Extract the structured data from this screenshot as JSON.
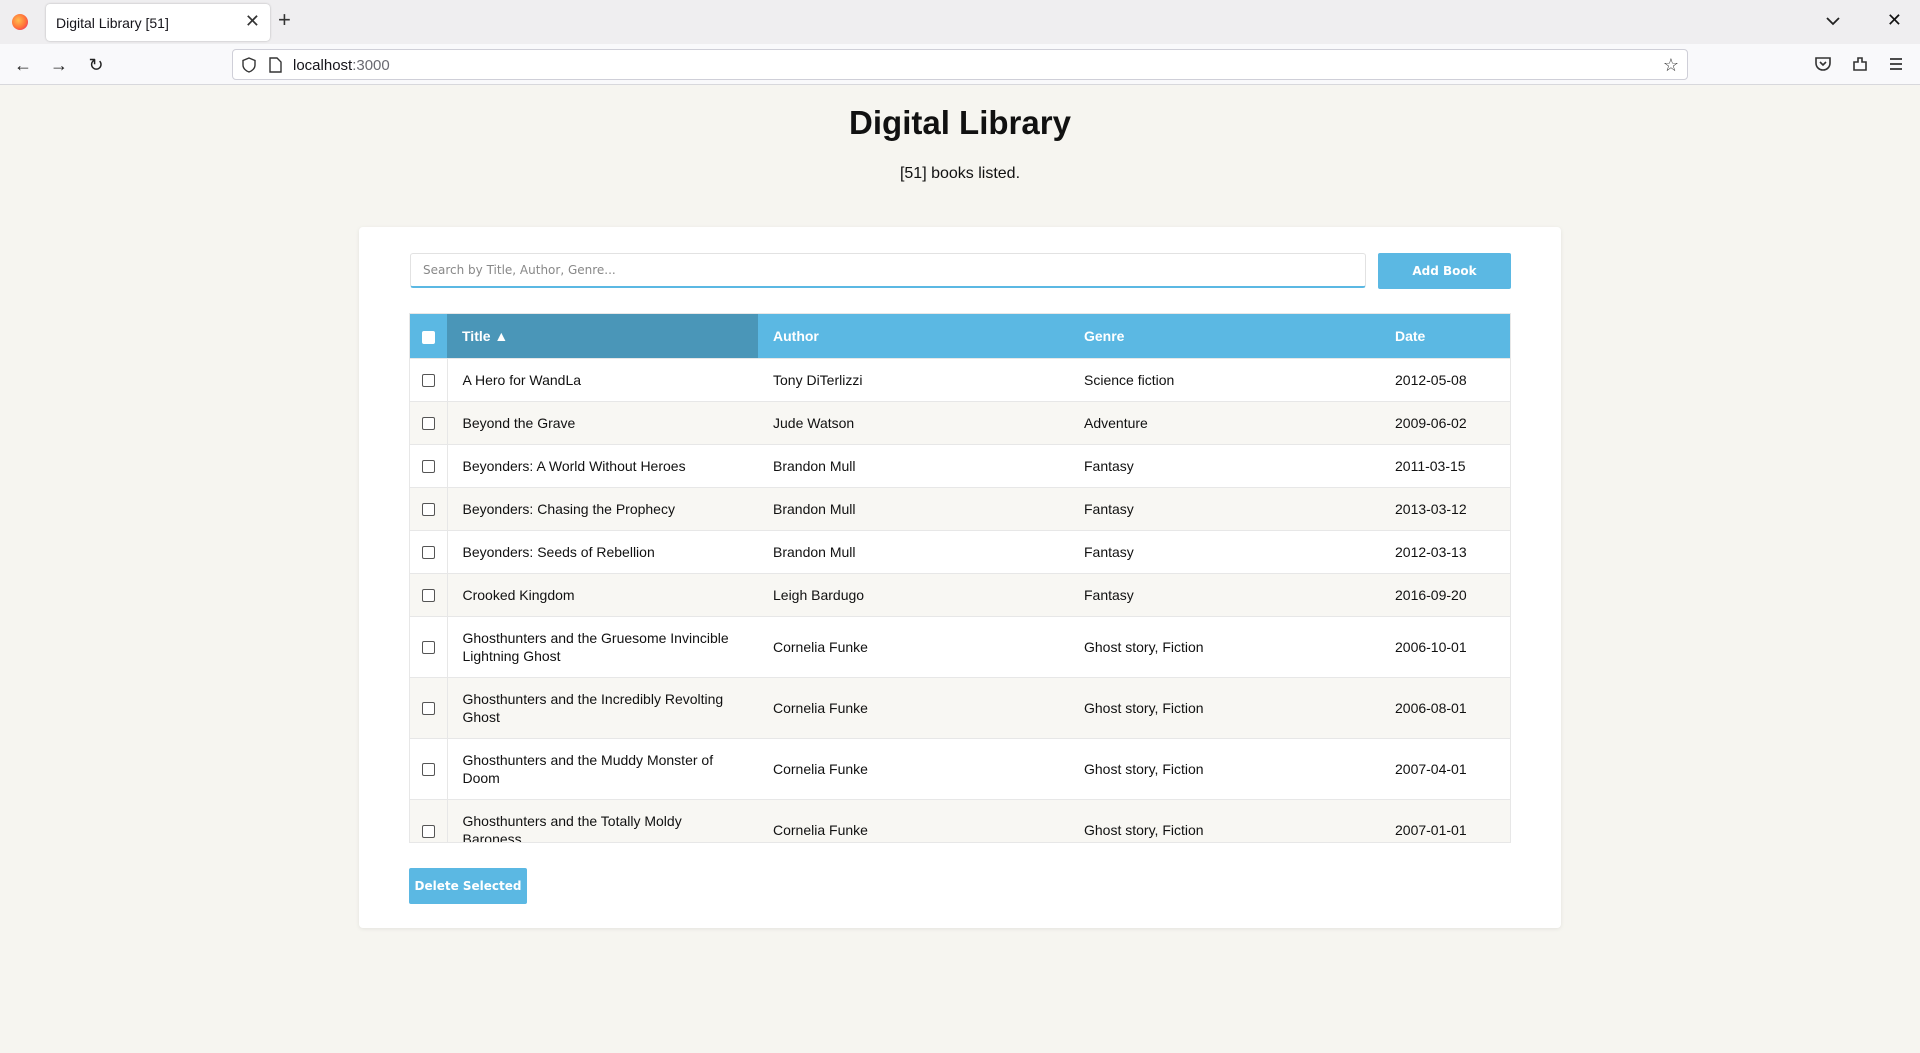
{
  "browser": {
    "tab_title": "Digital Library [51]",
    "url_host": "localhost",
    "url_port": ":3000"
  },
  "page": {
    "title": "Digital Library",
    "count_text": "[51] books listed."
  },
  "controls": {
    "search_placeholder": "Search by Title, Author, Genre...",
    "add_label": "Add Book",
    "delete_label": "Delete Selected"
  },
  "table": {
    "headers": {
      "title": "Title ▲",
      "author": "Author",
      "genre": "Genre",
      "date": "Date"
    },
    "sorted_by": "title",
    "rows": [
      {
        "title": "A Hero for WandLa",
        "author": "Tony DiTerlizzi",
        "genre": "Science fiction",
        "date": "2012-05-08"
      },
      {
        "title": "Beyond the Grave",
        "author": "Jude Watson",
        "genre": "Adventure",
        "date": "2009-06-02"
      },
      {
        "title": "Beyonders: A World Without Heroes",
        "author": "Brandon Mull",
        "genre": "Fantasy",
        "date": "2011-03-15"
      },
      {
        "title": "Beyonders: Chasing the Prophecy",
        "author": "Brandon Mull",
        "genre": "Fantasy",
        "date": "2013-03-12"
      },
      {
        "title": "Beyonders: Seeds of Rebellion",
        "author": "Brandon Mull",
        "genre": "Fantasy",
        "date": "2012-03-13"
      },
      {
        "title": "Crooked Kingdom",
        "author": "Leigh Bardugo",
        "genre": "Fantasy",
        "date": "2016-09-20"
      },
      {
        "title": "Ghosthunters and the Gruesome Invincible Lightning Ghost",
        "author": "Cornelia Funke",
        "genre": "Ghost story, Fiction",
        "date": "2006-10-01"
      },
      {
        "title": "Ghosthunters and the Incredibly Revolting Ghost",
        "author": "Cornelia Funke",
        "genre": "Ghost story, Fiction",
        "date": "2006-08-01"
      },
      {
        "title": "Ghosthunters and the Muddy Monster of Doom",
        "author": "Cornelia Funke",
        "genre": "Ghost story, Fiction",
        "date": "2007-04-01"
      },
      {
        "title": "Ghosthunters and the Totally Moldy Baroness",
        "author": "Cornelia Funke",
        "genre": "Ghost story, Fiction",
        "date": "2007-01-01"
      }
    ]
  },
  "colors": {
    "accent": "#5bb8e3",
    "sorted_header": "#4a96b8",
    "page_bg": "#f6f5f0"
  }
}
